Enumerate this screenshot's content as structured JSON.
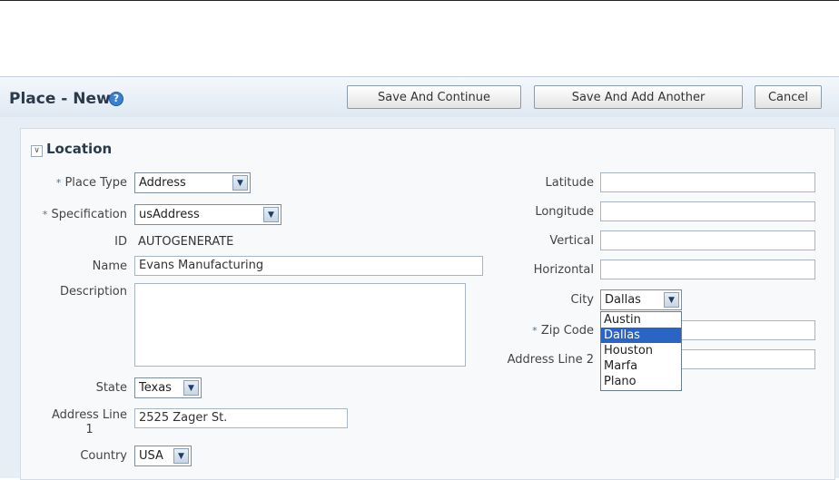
{
  "header": {
    "title": "Place - New",
    "help_glyph": "?",
    "buttons": {
      "save_continue": "Save And Continue",
      "save_add_another": "Save And Add Another",
      "cancel": "Cancel"
    }
  },
  "section": {
    "toggle_glyph": "∨",
    "title": "Location"
  },
  "required_marker": "*",
  "left": {
    "place_type": {
      "label": "Place Type",
      "value": "Address"
    },
    "specification": {
      "label": "Specification",
      "value": "usAddress"
    },
    "id": {
      "label": "ID",
      "value": "AUTOGENERATE"
    },
    "name": {
      "label": "Name",
      "value": "Evans Manufacturing"
    },
    "description": {
      "label": "Description",
      "value": ""
    },
    "state": {
      "label": "State",
      "value": "Texas"
    },
    "address_line_1": {
      "label_line1": "Address Line",
      "label_line2": "1",
      "value": "2525 Zager St."
    },
    "country": {
      "label": "Country",
      "value": "USA"
    }
  },
  "right": {
    "latitude": {
      "label": "Latitude",
      "value": ""
    },
    "longitude": {
      "label": "Longitude",
      "value": ""
    },
    "vertical": {
      "label": "Vertical",
      "value": ""
    },
    "horizontal": {
      "label": "Horizontal",
      "value": ""
    },
    "city": {
      "label": "City",
      "value": "Dallas",
      "options": [
        "Austin",
        "Dallas",
        "Houston",
        "Marfa",
        "Plano"
      ]
    },
    "zip_code": {
      "label": "Zip Code",
      "value": ""
    },
    "address_line_2": {
      "label": "Address Line 2",
      "value": ""
    }
  },
  "arrow_glyph": "▼",
  "colors": {
    "header_bg": "#dfe8f2",
    "panel_bg": "#e8eef5",
    "selected_option": "#2a64c5"
  }
}
